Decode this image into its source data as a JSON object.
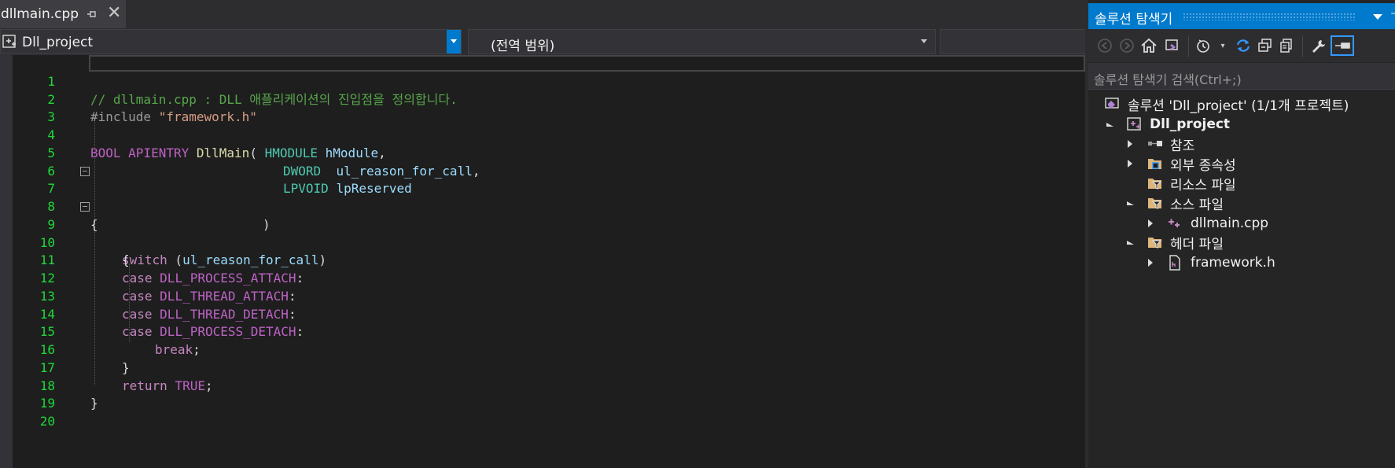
{
  "editor": {
    "tab": {
      "filename": "dllmain.cpp",
      "pin_icon": "pin-icon",
      "close_icon": "close-icon"
    },
    "nav": {
      "project": "Dll_project",
      "scope": "(전역 범위)",
      "member": ""
    },
    "lines": [
      {
        "num": "1"
      },
      {
        "num": "2"
      },
      {
        "num": "3"
      },
      {
        "num": "4"
      },
      {
        "num": "5"
      },
      {
        "num": "6"
      },
      {
        "num": "7"
      },
      {
        "num": "8"
      },
      {
        "num": "9"
      },
      {
        "num": "10"
      },
      {
        "num": "11"
      },
      {
        "num": "12"
      },
      {
        "num": "13"
      },
      {
        "num": "14"
      },
      {
        "num": "15"
      },
      {
        "num": "16"
      },
      {
        "num": "17"
      },
      {
        "num": "18"
      },
      {
        "num": "19"
      },
      {
        "num": "20"
      }
    ],
    "tokens": {
      "l1_comment": "// dllmain.cpp : DLL 애플리케이션의 진입점을 정의합니다.",
      "l2_pre": "#include ",
      "l2_str": "\"framework.h\"",
      "l4_type": "BOOL",
      "l4_call": "APIENTRY",
      "l4_fn": "DllMain",
      "l4_open": "( ",
      "l4_ptype": "HMODULE",
      "l4_param": "hModule",
      "l4_comma": ",",
      "l5_ptype": "DWORD",
      "l5_param": "ul_reason_for_call",
      "l5_comma": ",",
      "l6_ptype": "LPVOID",
      "l6_param": "lpReserved",
      "l7_close": ")",
      "l8_brace": "{",
      "l9_kw": "switch",
      "l9_open": " (",
      "l9_param": "ul_reason_for_call",
      "l9_close": ")",
      "l10_brace": "{",
      "l11_kw": "case",
      "l11_mac": "DLL_PROCESS_ATTACH",
      "l11_colon": ":",
      "l12_kw": "case",
      "l12_mac": "DLL_THREAD_ATTACH",
      "l12_colon": ":",
      "l13_kw": "case",
      "l13_mac": "DLL_THREAD_DETACH",
      "l13_colon": ":",
      "l14_kw": "case",
      "l14_mac": "DLL_PROCESS_DETACH",
      "l14_colon": ":",
      "l15_kw": "break",
      "l15_semi": ";",
      "l16_brace": "}",
      "l17_kw": "return",
      "l17_mac": "TRUE",
      "l17_semi": ";",
      "l18_brace": "}"
    }
  },
  "solution_explorer": {
    "title": "솔루션 탐색기",
    "search_placeholder": "솔루션 탐색기 검색(Ctrl+;)",
    "toolbar_icons": [
      "back-icon",
      "forward-icon",
      "home-icon",
      "vs-switch-views-icon",
      "history-icon",
      "refresh-icon",
      "collapse-all-icon",
      "show-all-files-icon",
      "properties-icon",
      "preview-icon"
    ],
    "tree": {
      "solution": "솔루션 'Dll_project' (1/1개 프로젝트)",
      "project": "Dll_project",
      "references": "참조",
      "external_deps": "외부 종속성",
      "resource_files": "리소스 파일",
      "source_files": "소스 파일",
      "dllmain": "dllmain.cpp",
      "header_files": "헤더 파일",
      "framework": "framework.h"
    }
  },
  "colors": {
    "accent": "#007acc",
    "background": "#1e1e1e",
    "line_numbers": "#1fd93a",
    "comment": "#57a64a",
    "keyword": "#c586c0",
    "macro": "#bd63c5",
    "type": "#4ec9b0",
    "parameter": "#9cdcfe"
  }
}
